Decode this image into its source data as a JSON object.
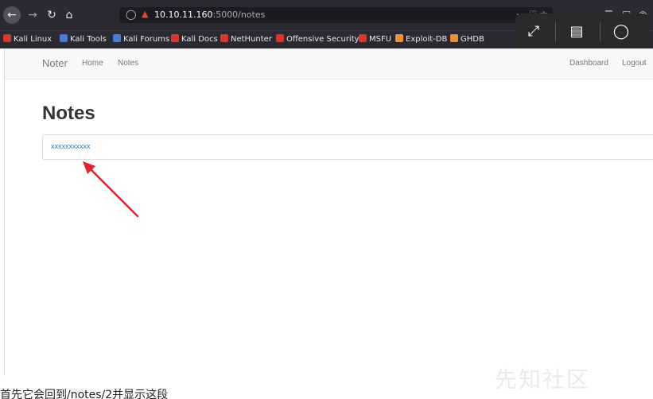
{
  "browser": {
    "url_host": "10.10.11.160",
    "url_rest": ":5000/notes",
    "toolbar_icons": [
      "back-icon",
      "forward-icon",
      "reload-icon",
      "home-icon",
      "shield-icon",
      "insecure-lock-icon",
      "more-icon",
      "pocket-icon",
      "star-icon",
      "library-icon",
      "sidebar-icon",
      "account-icon"
    ]
  },
  "overlay": {
    "icons": [
      "expand-icon",
      "ocr-icon",
      "chat-icon"
    ]
  },
  "bookmarks": [
    {
      "label": "Kali Linux",
      "color": "#d63a2f"
    },
    {
      "label": "Kali Tools",
      "color": "#4a7bd4"
    },
    {
      "label": "Kali Forums",
      "color": "#4a7bd4"
    },
    {
      "label": "Kali Docs",
      "color": "#d63a2f"
    },
    {
      "label": "NetHunter",
      "color": "#d63a2f"
    },
    {
      "label": "Offensive Security",
      "color": "#d63a2f"
    },
    {
      "label": "MSFU",
      "color": "#d63a2f"
    },
    {
      "label": "Exploit-DB",
      "color": "#e8913a"
    },
    {
      "label": "GHDB",
      "color": "#e8913a"
    }
  ],
  "navbar": {
    "brand": "Noter",
    "home": "Home",
    "notes": "Notes",
    "dashboard": "Dashboard",
    "logout": "Logout"
  },
  "main": {
    "title": "Notes",
    "notes": [
      "xxxxxxxxxxx"
    ]
  },
  "annotation": {
    "arrow_color": "#e0242a"
  },
  "caption": "首先它会回到/notes/2并显示这段",
  "watermark": "先知社区"
}
